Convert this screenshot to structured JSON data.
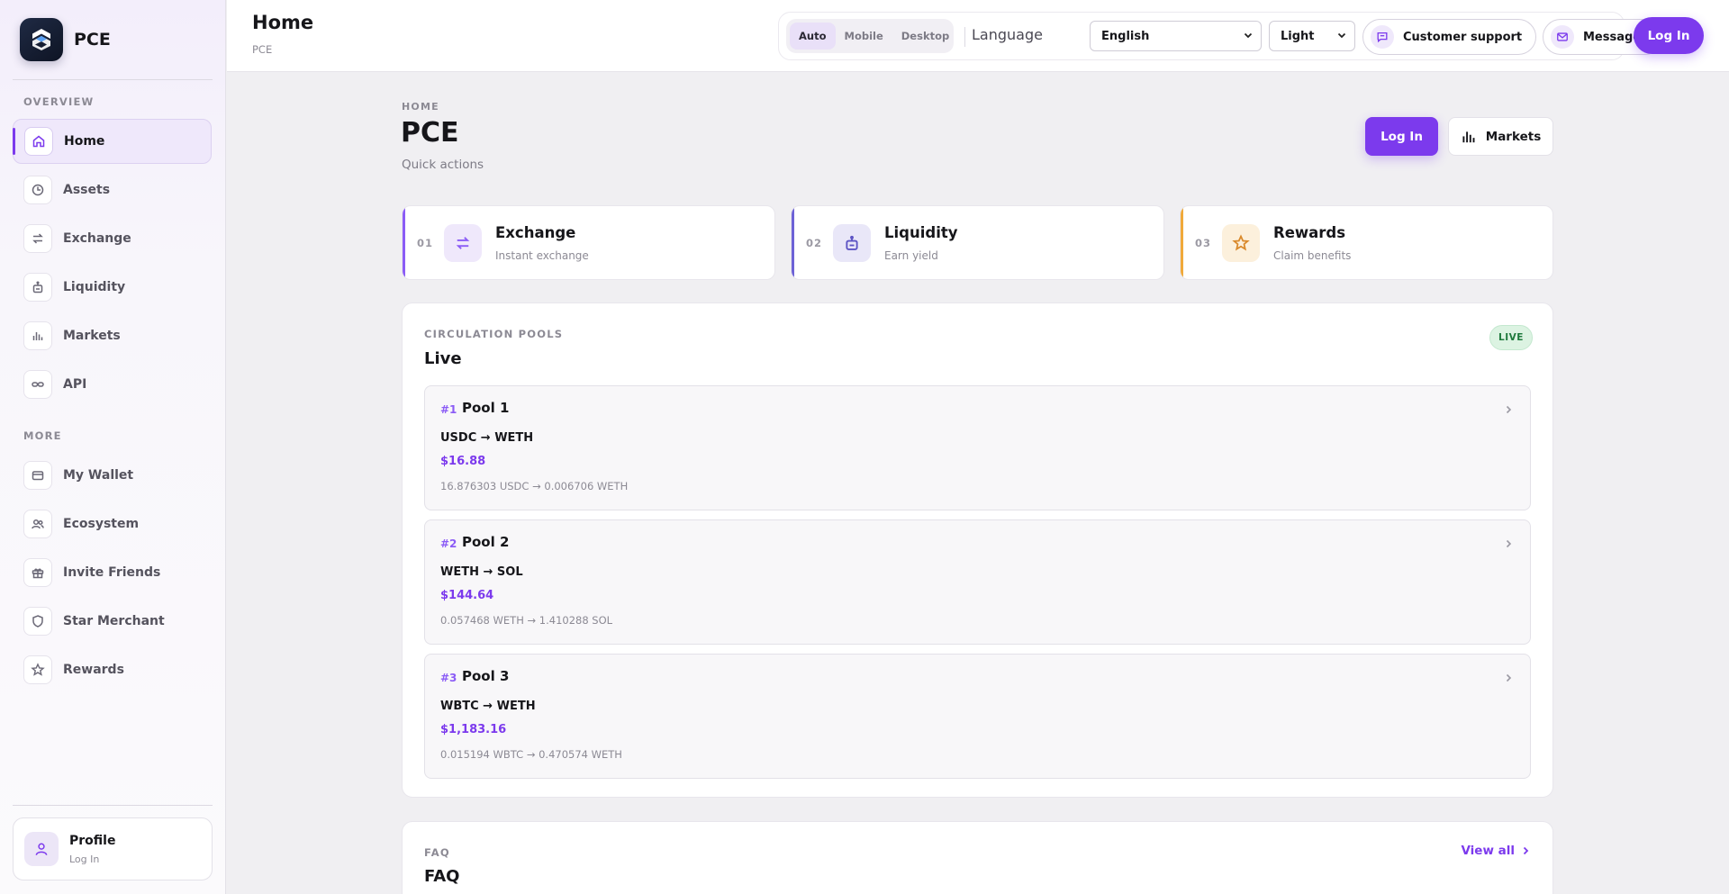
{
  "brand": {
    "name": "PCE"
  },
  "sidebar": {
    "overview_label": "OVERVIEW",
    "more_label": "MORE",
    "overview_items": [
      {
        "label": "Home",
        "icon": "home-icon"
      },
      {
        "label": "Assets",
        "icon": "clock-pie-icon"
      },
      {
        "label": "Exchange",
        "icon": "swap-icon"
      },
      {
        "label": "Liquidity",
        "icon": "robot-icon"
      },
      {
        "label": "Markets",
        "icon": "bar-chart-icon"
      },
      {
        "label": "API",
        "icon": "link-icon"
      }
    ],
    "more_items": [
      {
        "label": "My Wallet",
        "icon": "wallet-icon"
      },
      {
        "label": "Ecosystem",
        "icon": "users-icon"
      },
      {
        "label": "Invite Friends",
        "icon": "gift-icon"
      },
      {
        "label": "Star Merchant",
        "icon": "shield-icon"
      },
      {
        "label": "Rewards",
        "icon": "star-icon"
      }
    ],
    "profile": {
      "name": "Profile",
      "sub": "Log In"
    }
  },
  "header": {
    "title": "Home",
    "subtitle": "PCE",
    "view_modes": [
      "Auto",
      "Mobile",
      "Desktop"
    ],
    "active_view_mode": "Auto",
    "language_label": "Language",
    "language_value": "English",
    "theme_value": "Light",
    "support_label": "Customer support",
    "messages_label": "Messages",
    "login_label": "Log In"
  },
  "main": {
    "crumb": "HOME",
    "title": "PCE",
    "subtitle": "Quick actions",
    "login_label": "Log In",
    "markets_label": "Markets",
    "quick_actions": [
      {
        "num": "01",
        "title": "Exchange",
        "sub": "Instant exchange",
        "icon": "swap-icon"
      },
      {
        "num": "02",
        "title": "Liquidity",
        "sub": "Earn yield",
        "icon": "robot-icon"
      },
      {
        "num": "03",
        "title": "Rewards",
        "sub": "Claim benefits",
        "icon": "star-icon"
      }
    ],
    "pools_section": {
      "label": "CIRCULATION POOLS",
      "title": "Live",
      "badge": "LIVE",
      "pools": [
        {
          "rank": "#1",
          "name": "Pool 1",
          "pair": "USDC → WETH",
          "value": "$16.88",
          "detail": "16.876303 USDC → 0.006706 WETH"
        },
        {
          "rank": "#2",
          "name": "Pool 2",
          "pair": "WETH → SOL",
          "value": "$144.64",
          "detail": "0.057468 WETH → 1.410288 SOL"
        },
        {
          "rank": "#3",
          "name": "Pool 3",
          "pair": "WBTC → WETH",
          "value": "$1,183.16",
          "detail": "0.015194 WBTC → 0.470574 WETH"
        }
      ]
    },
    "faq_section": {
      "label": "FAQ",
      "title": "FAQ",
      "view_all": "View all"
    }
  },
  "colors": {
    "accent": "#7c3aed",
    "live": "#1e7a3c",
    "amber": "#f0a93a"
  }
}
